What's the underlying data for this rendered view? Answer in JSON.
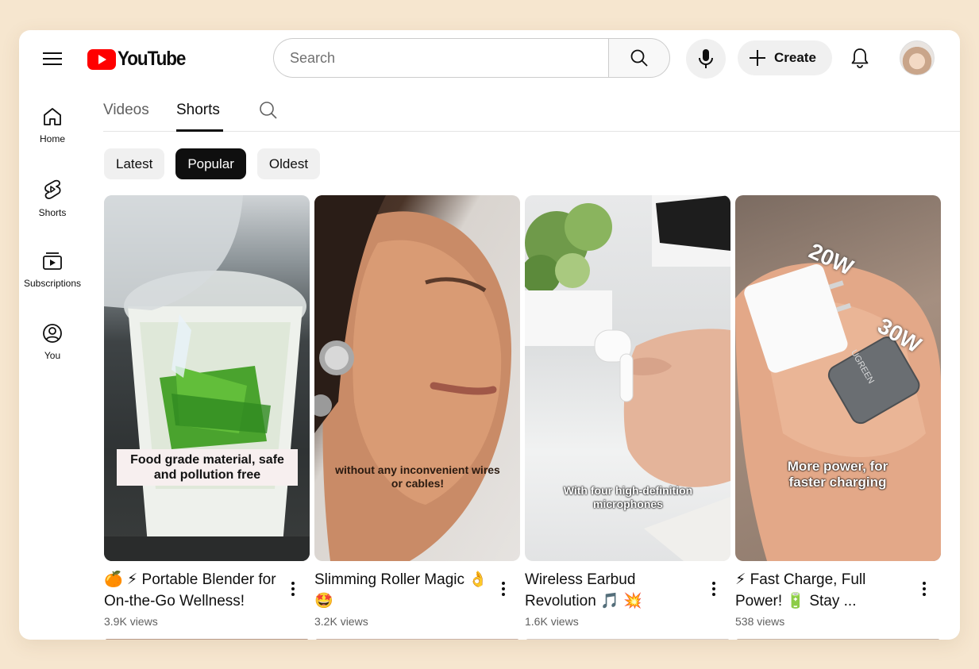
{
  "header": {
    "logo_text": "YouTube",
    "search_placeholder": "Search",
    "create_label": "Create"
  },
  "sidebar": {
    "items": [
      {
        "label": "Home",
        "icon": "home-icon"
      },
      {
        "label": "Shorts",
        "icon": "shorts-icon"
      },
      {
        "label": "Subscriptions",
        "icon": "subscriptions-icon"
      },
      {
        "label": "You",
        "icon": "you-icon"
      }
    ]
  },
  "tabs": {
    "videos": "Videos",
    "shorts": "Shorts",
    "active": "Shorts"
  },
  "chips": {
    "latest": "Latest",
    "popular": "Popular",
    "oldest": "Oldest",
    "active": "Popular"
  },
  "shorts": [
    {
      "title": "🍊 ⚡ Portable Blender for On-the-Go Wellness!",
      "views": "3.9K views",
      "caption": "Food grade material, safe and pollution free"
    },
    {
      "title": "Slimming Roller Magic 👌 🤩",
      "views": "3.2K views",
      "caption": "without any inconvenient wires or cables!"
    },
    {
      "title": "Wireless Earbud Revolution 🎵 💥",
      "views": "1.6K views",
      "caption": "With four high-definition microphones"
    },
    {
      "title": "⚡ Fast Charge, Full Power! 🔋 Stay ...",
      "views": "538 views",
      "caption": "More power, for faster charging",
      "label_20w": "20W",
      "label_30w": "30W",
      "brand": "UGREEN"
    }
  ],
  "colors": {
    "brand_red": "#ff0000",
    "background": "#f6e6cf",
    "chip_active": "#0f0f0f"
  }
}
